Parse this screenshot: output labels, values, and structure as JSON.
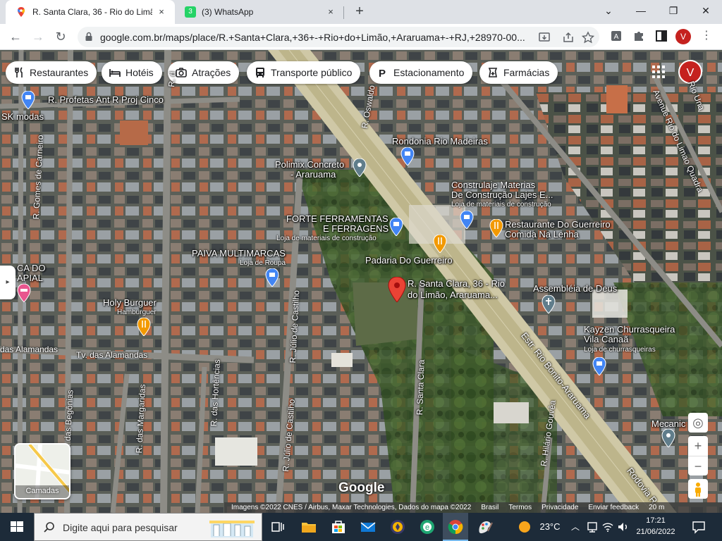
{
  "browser": {
    "tabs": [
      {
        "title": "R. Santa Clara, 36 - Rio do Limão",
        "close": "×"
      },
      {
        "title": "(3) WhatsApp",
        "badge": "3",
        "close": "×"
      }
    ],
    "new_tab": "+",
    "window_controls": [
      "⌄",
      "—",
      "❐",
      "✕"
    ],
    "nav": {
      "back": "←",
      "forward": "→",
      "reload": "↻"
    },
    "url": "google.com.br/maps/place/R.+Santa+Clara,+36+-+Rio+do+Limão,+Araruama+-+RJ,+28970-00...",
    "profile_initial": "V"
  },
  "map": {
    "chips": [
      {
        "label": "Restaurantes",
        "icon": "fork-knife-icon"
      },
      {
        "label": "Hotéis",
        "icon": "bed-icon"
      },
      {
        "label": "Atrações",
        "icon": "camera-icon"
      },
      {
        "label": "Transporte público",
        "icon": "bus-icon"
      },
      {
        "label": "Estacionamento",
        "icon": "parking-icon"
      },
      {
        "label": "Farmácias",
        "icon": "pharmacy-icon"
      }
    ],
    "avatar_initial": "V",
    "places": [
      {
        "name": "SK modas"
      },
      {
        "name": "R. Profetas Ant R Proj Cinco"
      },
      {
        "name": "Polimix Concreto",
        "name2": "- Araruama"
      },
      {
        "name": "Rondonia Rio Madeiras"
      },
      {
        "name": "Construlaje Materias",
        "name2": "De Construção Lajes E...",
        "category": "Loja de materiais de construção"
      },
      {
        "name": "FORTE FERRAMENTAS",
        "name2": "E FERRAGENS",
        "category": "Loja de materiais de construção"
      },
      {
        "name": "Restaurante Do Guerreiro",
        "name2": "Comida Na Lenha"
      },
      {
        "name": "PAIVA MULTIMARCAS",
        "category": "Loja de Roupa"
      },
      {
        "name": "Padaria Do Guerreiro"
      },
      {
        "name": "R. Santa Clara, 36 - Rio",
        "name2": "do Limão, Araruama..."
      },
      {
        "name": "Assembléia de Deus"
      },
      {
        "name": "Holy Burguer",
        "category": "Hamburguer"
      },
      {
        "name": "Kayzen Churrasqueira",
        "name2": "Vila Canaã",
        "category": "Loja de churrasqueiras"
      },
      {
        "name": "Mecanic"
      },
      {
        "name": "CA DO",
        "name2": "APIAL"
      }
    ],
    "streets": [
      "R. Gomes de Carneiro",
      "das Alamandas",
      "Tv. das Alamandas",
      "R. das Begônias",
      "R. das Margaridas",
      "R. das Hortências",
      "R. Júlio de Castilho",
      "R. Júlio de Castilho",
      "R. Santa Clara",
      "Estr. Rio Bonito-Araruama",
      "R. Hilário Gouvêa",
      "Rodovia R",
      "Avenue Rio do Limao Quadra",
      "Rio Una",
      "R. Oswaldo",
      "R. d"
    ],
    "layers_label": "Camadas",
    "google_logo": "Google",
    "zoom_in": "+",
    "zoom_out": "−",
    "attribution": [
      "Imagens ©2022 CNES / Airbus, Maxar Technologies, Dados do mapa ©2022",
      "Brasil",
      "Termos",
      "Privacidade",
      "Enviar feedback",
      "20 m"
    ]
  },
  "taskbar": {
    "search_placeholder": "Digite aqui para pesquisar",
    "weather": "23°C",
    "time": "17:21",
    "date": "21/06/2022"
  }
}
